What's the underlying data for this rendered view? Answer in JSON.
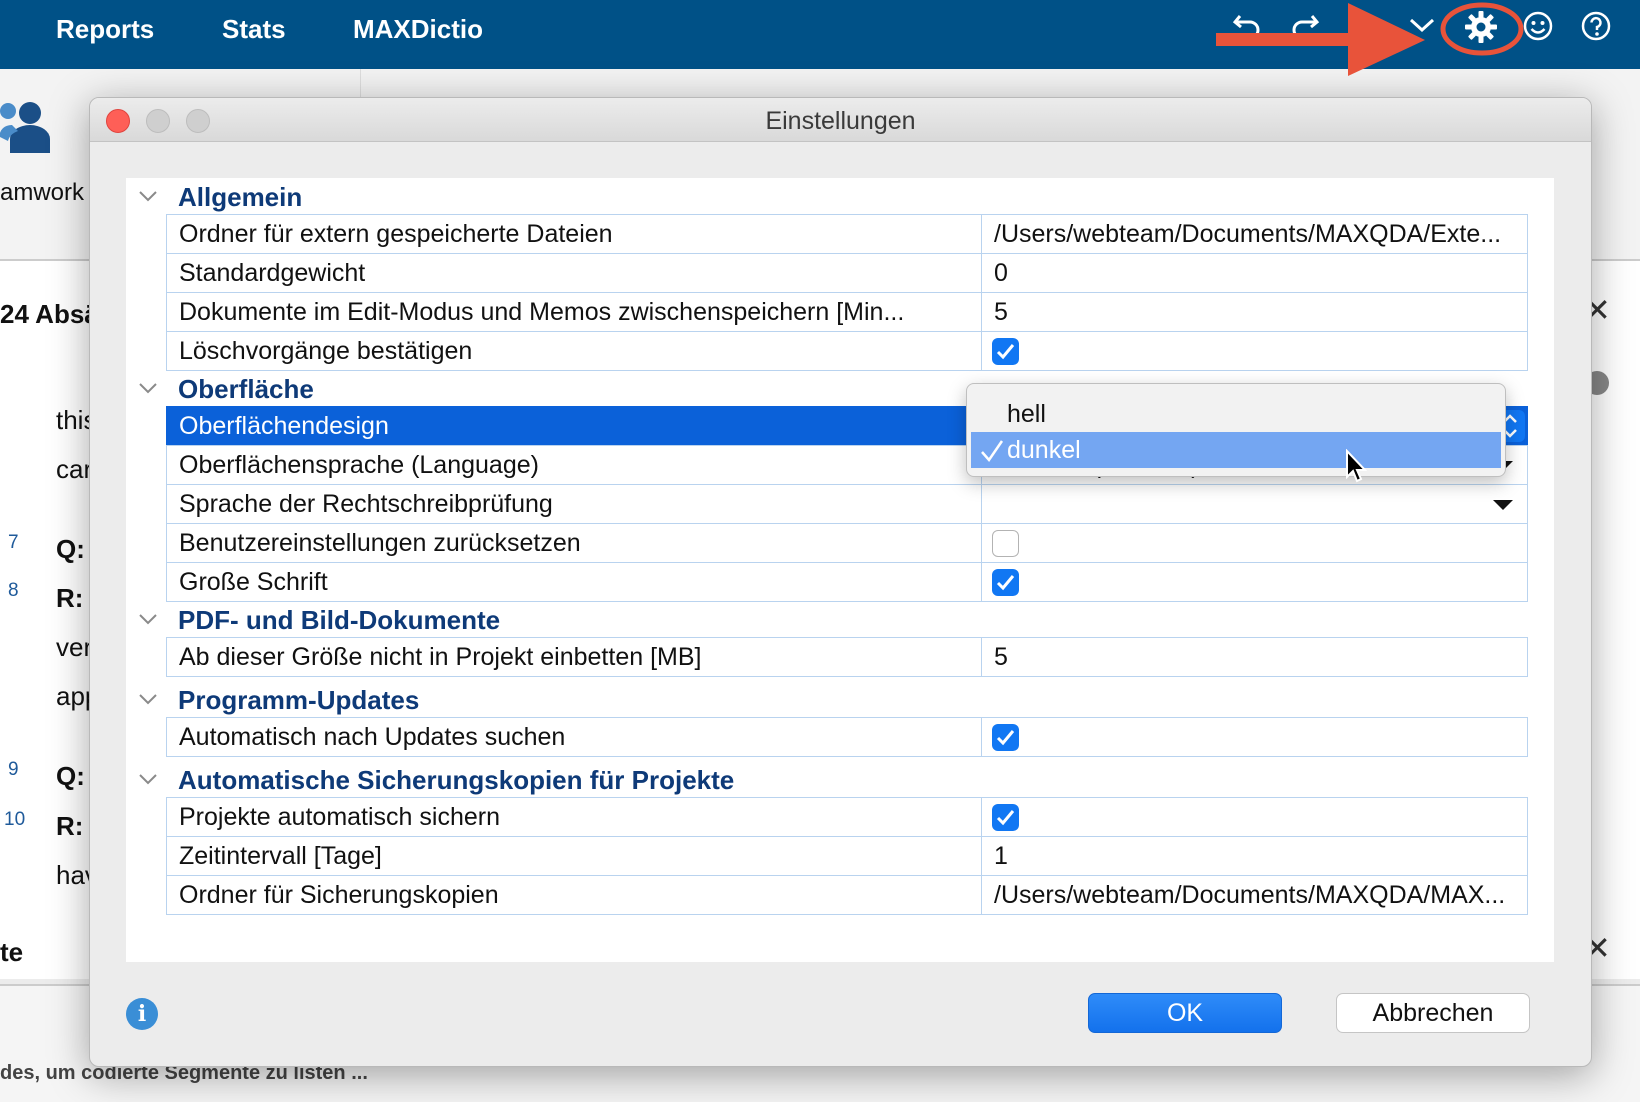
{
  "topbar": {
    "menu": [
      "Reports",
      "Stats",
      "MAXDictio"
    ],
    "icons": [
      "undo-icon",
      "redo-icon",
      "chevron-down-icon",
      "gear-icon",
      "smiley-icon",
      "help-icon"
    ]
  },
  "background": {
    "sidebar_label": "amwork",
    "panel_title": "24 Absä",
    "snippets": [
      "this",
      "car",
      "Q:",
      "R:",
      "ver",
      "app",
      "Q:",
      "R:",
      "hav"
    ],
    "line_numbers": [
      "7",
      "8",
      "9",
      "10"
    ],
    "bottom_title": "te",
    "bottom_text": "des, um codierte Segmente zu listen ..."
  },
  "dialog": {
    "title": "Einstellungen",
    "sections": [
      {
        "label": "Allgemein",
        "rows": [
          {
            "name": "Ordner für extern gespeicherte Dateien",
            "value": "/Users/webteam/Documents/MAXQDA/Exte..."
          },
          {
            "name": "Standardgewicht",
            "value": "0"
          },
          {
            "name": "Dokumente im Edit-Modus und Memos zwischenspeichern [Min...",
            "value": "5"
          },
          {
            "name": "Löschvorgänge bestätigen",
            "checked": true
          }
        ]
      },
      {
        "label": "Oberfläche",
        "rows": [
          {
            "name": "Oberflächendesign",
            "value": "dunkel"
          },
          {
            "name": "Oberflächensprache (Language)",
            "value": "Deutsch (German)"
          },
          {
            "name": "Sprache der Rechtschreibprüfung",
            "value": ""
          },
          {
            "name": "Benutzereinstellungen zurücksetzen",
            "checked": false
          },
          {
            "name": "Große Schrift",
            "checked": true
          }
        ]
      },
      {
        "label": "PDF- und Bild-Dokumente",
        "rows": [
          {
            "name": "Ab dieser Größe nicht in Projekt einbetten [MB]",
            "value": "5"
          }
        ]
      },
      {
        "label": "Programm-Updates",
        "rows": [
          {
            "name": "Automatisch nach Updates suchen",
            "checked": true
          }
        ]
      },
      {
        "label": "Automatische Sicherungskopien für Projekte",
        "rows": [
          {
            "name": "Projekte automatisch sichern",
            "checked": true
          },
          {
            "name": "Zeitintervall [Tage]",
            "value": "1"
          },
          {
            "name": "Ordner für Sicherungskopien",
            "value": "/Users/webteam/Documents/MAXQDA/MAX..."
          }
        ]
      }
    ],
    "popup": {
      "options": [
        "hell",
        "dunkel"
      ],
      "selected": "dunkel"
    },
    "buttons": {
      "ok": "OK",
      "cancel": "Abbrechen"
    }
  },
  "colors": {
    "topbar": "#005187",
    "section_label": "#0e3a78",
    "selection": "#0b61d9",
    "checkbox": "#1177f3",
    "annotation": "#e8533a"
  }
}
